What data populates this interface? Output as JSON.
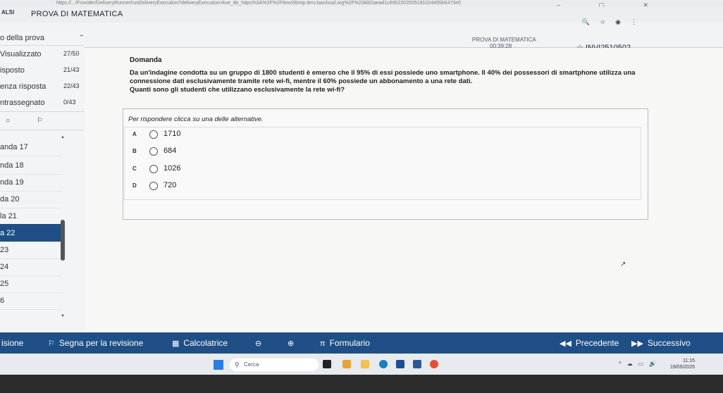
{
  "browser": {
    "url": "https://.../Provider/DeliveryRunner/runDeliveryExecution?deliveryExecution=kve_de_https%3A%2F%2Fitmv06mtp.itmv.taocloud.org%2F%23i682aead1c6952202505191024495b6473e0",
    "window_controls": "– ▢ ✕"
  },
  "app": {
    "logo": "ALSI",
    "title": "PROVA DI MATEMATICA"
  },
  "header": {
    "exam_name": "PROVA DI MATEMATICA",
    "timer": "00:39:28",
    "user": "INVI2510502…"
  },
  "sidebar": {
    "section": "o della prova",
    "stats": [
      {
        "label": "Visualizzato",
        "value": "27/50"
      },
      {
        "label": "isposto",
        "value": "21/43"
      },
      {
        "label": "enza risposta",
        "value": "22/43"
      },
      {
        "label": "ntrassegnato",
        "value": "0/43"
      }
    ],
    "questions": [
      "anda 17",
      "nda 18",
      "nda 19",
      "da 20",
      "la 21",
      "a 22",
      "23",
      "24",
      "25",
      "6"
    ],
    "active_index": 5
  },
  "question": {
    "section_label": "Domanda",
    "text": "Da un'indagine condotta su un gruppo di 1800 studenti è emerso che il 95% di essi possiede uno smartphone. Il 40% dei possessori di smartphone utilizza una connessione dati esclusivamente tramite rete wi-fi, mentre il 60% possiede un abbonamento a una rete dati.",
    "prompt": "Quanti sono gli studenti che utilizzano esclusivamente la rete wi-fi?",
    "instruction": "Per rispondere clicca su una delle alternative.",
    "options": [
      {
        "letter": "A",
        "text": "1710"
      },
      {
        "letter": "B",
        "text": "684"
      },
      {
        "letter": "C",
        "text": "1026"
      },
      {
        "letter": "D",
        "text": "720"
      }
    ]
  },
  "bottom_bar": {
    "revision": "isione",
    "mark": "Segna per la revisione",
    "calculator": "Calcolatrice",
    "formulario": "Formulario",
    "prev": "Precedente",
    "next": "Successivo"
  },
  "taskbar": {
    "search_placeholder": "Cerca",
    "time": "11:15",
    "date": "19/05/2025"
  },
  "colors": {
    "accent": "#1f4f86",
    "background": "#f7f7f6"
  }
}
